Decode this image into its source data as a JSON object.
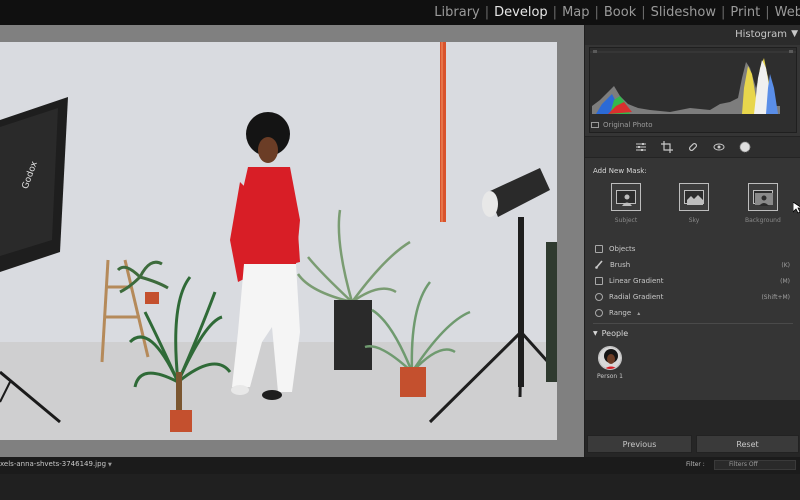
{
  "modules": [
    {
      "label": "Library",
      "active": false
    },
    {
      "label": "Develop",
      "active": true
    },
    {
      "label": "Map",
      "active": false
    },
    {
      "label": "Book",
      "active": false
    },
    {
      "label": "Slideshow",
      "active": false
    },
    {
      "label": "Print",
      "active": false
    },
    {
      "label": "Web",
      "active": false
    }
  ],
  "histogram": {
    "title": "Histogram",
    "original_photo_label": "Original Photo"
  },
  "tool_icons": [
    "sliders-icon",
    "crop-icon",
    "healing-icon",
    "redeye-icon",
    "masking-icon"
  ],
  "mask": {
    "title": "Add New Mask:",
    "buttons": [
      {
        "label": "Subject",
        "icon": "subject-icon"
      },
      {
        "label": "Sky",
        "icon": "sky-icon"
      },
      {
        "label": "Background",
        "icon": "background-icon"
      }
    ],
    "tools": [
      {
        "label": "Objects",
        "shortcut": "",
        "icon": "objects-icon"
      },
      {
        "label": "Brush",
        "shortcut": "(K)",
        "icon": "brush-icon"
      },
      {
        "label": "Linear Gradient",
        "shortcut": "(M)",
        "icon": "linear-gradient-icon"
      },
      {
        "label": "Radial Gradient",
        "shortcut": "(Shift+M)",
        "icon": "radial-gradient-icon"
      },
      {
        "label": "Range",
        "shortcut": "",
        "icon": "range-icon"
      }
    ]
  },
  "people": {
    "title": "People",
    "persons": [
      {
        "label": "Person 1"
      }
    ]
  },
  "buttons": {
    "previous": "Previous",
    "reset": "Reset"
  },
  "filmstrip": {
    "filename": "xels-anna-shvets-3746149.jpg",
    "filter_label": "Filter :",
    "filter_value": "Filters Off"
  },
  "colors": {
    "shirt_red": "#d81e26",
    "panel_bg": "#353535",
    "canvas_bg": "#808080"
  }
}
